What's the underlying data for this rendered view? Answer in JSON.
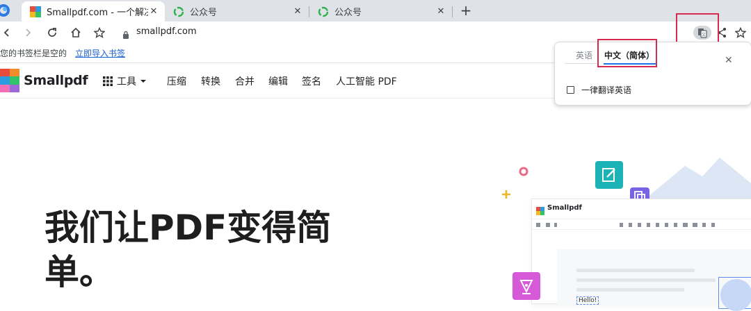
{
  "browser": {
    "tabs": [
      {
        "title": "Smallpdf.com - 一个解决",
        "close": "✕",
        "active": true
      },
      {
        "title": "公众号",
        "close": "✕",
        "active": false
      },
      {
        "title": "公众号",
        "close": "✕",
        "active": false
      }
    ],
    "new_tab": "+",
    "url": "smallpdf.com",
    "bookmarks_bar": {
      "message": "您的书签栏是空的",
      "import_link": "立即导入书签"
    }
  },
  "translate_popup": {
    "tab_source": "英语",
    "tab_target": "中文（简体）",
    "always_translate": "一律翻译英语",
    "close": "✕"
  },
  "site": {
    "brand": "Smallpdf",
    "tools_menu": "工具",
    "nav": [
      "压缩",
      "转换",
      "合并",
      "编辑",
      "签名",
      "人工智能 PDF"
    ],
    "hero_title_line1": "我们让PDF变得简",
    "hero_title_line2": "单。",
    "app_mock": {
      "brand": "Smallpdf",
      "sample_text": "Hello!"
    }
  },
  "colors": {
    "accent_red": "#d52b4d",
    "tab_strip": "#dfe3e8",
    "teal_icon": "#1bb3b6",
    "purple_icon": "#7a63e0",
    "pink_icon": "#d65ad8"
  }
}
